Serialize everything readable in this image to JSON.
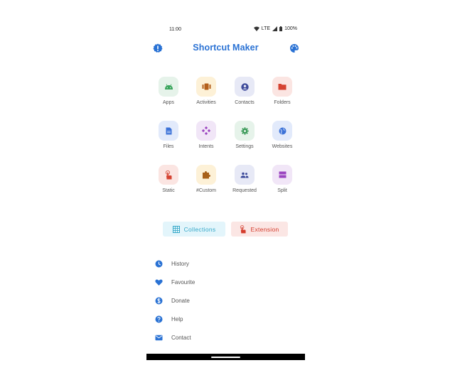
{
  "status": {
    "time": "11:00",
    "network": "LTE",
    "battery": "100%"
  },
  "appbar": {
    "title": "Shortcut Maker",
    "left_icon": "info-badge-icon",
    "right_icon": "palette-icon"
  },
  "grid": [
    {
      "label": "Apps",
      "icon": "android-icon",
      "bg": "#e6f3ea",
      "fg": "#3aa55c"
    },
    {
      "label": "Activities",
      "icon": "activity-icon",
      "bg": "#fdf1d7",
      "fg": "#b4601c"
    },
    {
      "label": "Contacts",
      "icon": "contact-icon",
      "bg": "#e7e9f6",
      "fg": "#3d4a9a"
    },
    {
      "label": "Folders",
      "icon": "folder-icon",
      "bg": "#fbe5e2",
      "fg": "#d54332"
    },
    {
      "label": "Files",
      "icon": "file-icon",
      "bg": "#e2eafb",
      "fg": "#3d73d8"
    },
    {
      "label": "Intents",
      "icon": "gamepad-icon",
      "bg": "#f1e6f7",
      "fg": "#9b45c0"
    },
    {
      "label": "Settings",
      "icon": "settings-icon",
      "bg": "#e6f3ea",
      "fg": "#3a9a58"
    },
    {
      "label": "Websites",
      "icon": "globe-icon",
      "bg": "#e2eafb",
      "fg": "#3d73d8"
    },
    {
      "label": "Static",
      "icon": "touch-icon",
      "bg": "#fbe5e2",
      "fg": "#d54332"
    },
    {
      "label": "#Custom",
      "icon": "puzzle-icon",
      "bg": "#fdf1d7",
      "fg": "#a8611a"
    },
    {
      "label": "Requested",
      "icon": "people-icon",
      "bg": "#e7e9f6",
      "fg": "#3d4a9a"
    },
    {
      "label": "Split",
      "icon": "split-icon",
      "bg": "#f1e6f7",
      "fg": "#9b45c0"
    }
  ],
  "chips": {
    "collections": {
      "label": "Collections",
      "icon": "grid-icon"
    },
    "extension": {
      "label": "Extension",
      "icon": "touch-icon"
    }
  },
  "menu": [
    {
      "label": "History",
      "icon": "clock-icon"
    },
    {
      "label": "Favourite",
      "icon": "heart-icon"
    },
    {
      "label": "Donate",
      "icon": "dollar-icon"
    },
    {
      "label": "Help",
      "icon": "help-icon"
    },
    {
      "label": "Contact",
      "icon": "mail-icon"
    }
  ],
  "colors": {
    "accent": "#2a72d4",
    "menu_icon": "#2a72d4"
  }
}
